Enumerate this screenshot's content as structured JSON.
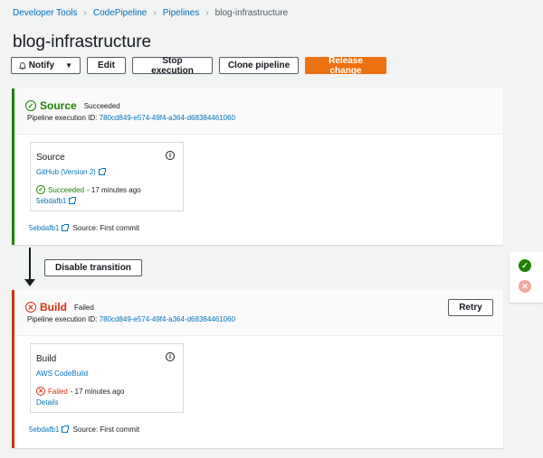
{
  "breadcrumb": {
    "items": [
      "Developer Tools",
      "CodePipeline",
      "Pipelines"
    ],
    "current": "blog-infrastructure"
  },
  "page": {
    "title": "blog-infrastructure"
  },
  "toolbar": {
    "notify": "Notify",
    "edit": "Edit",
    "stop": "Stop execution",
    "clone": "Clone pipeline",
    "release": "Release change"
  },
  "source_stage": {
    "name": "Source",
    "status": "Succeeded",
    "exec_label": "Pipeline execution ID:",
    "exec_id": "780cd849-e574-49f4-a364-d68384461060",
    "action": {
      "name": "Source",
      "provider": "GitHub (Version 2)",
      "status": "Succeeded",
      "time": "- 17 minutes ago",
      "link": "5ebdafb1"
    },
    "commit": {
      "id": "5ebdafb1",
      "message": "Source: First commit"
    }
  },
  "transition": {
    "button": "Disable transition"
  },
  "build_stage": {
    "name": "Build",
    "status": "Failed",
    "retry": "Retry",
    "exec_label": "Pipeline execution ID:",
    "exec_id": "780cd849-e574-49f4-a364-d68384461060",
    "action": {
      "name": "Build",
      "provider": "AWS CodeBuild",
      "status": "Failed",
      "time": "- 17 minutes ago",
      "link": "Details"
    },
    "commit": {
      "id": "5ebdafb1",
      "message": "Source: First commit"
    }
  },
  "colors": {
    "success": "#1d8102",
    "failure": "#d13212",
    "primary": "#ec7211",
    "link": "#0073bb"
  }
}
